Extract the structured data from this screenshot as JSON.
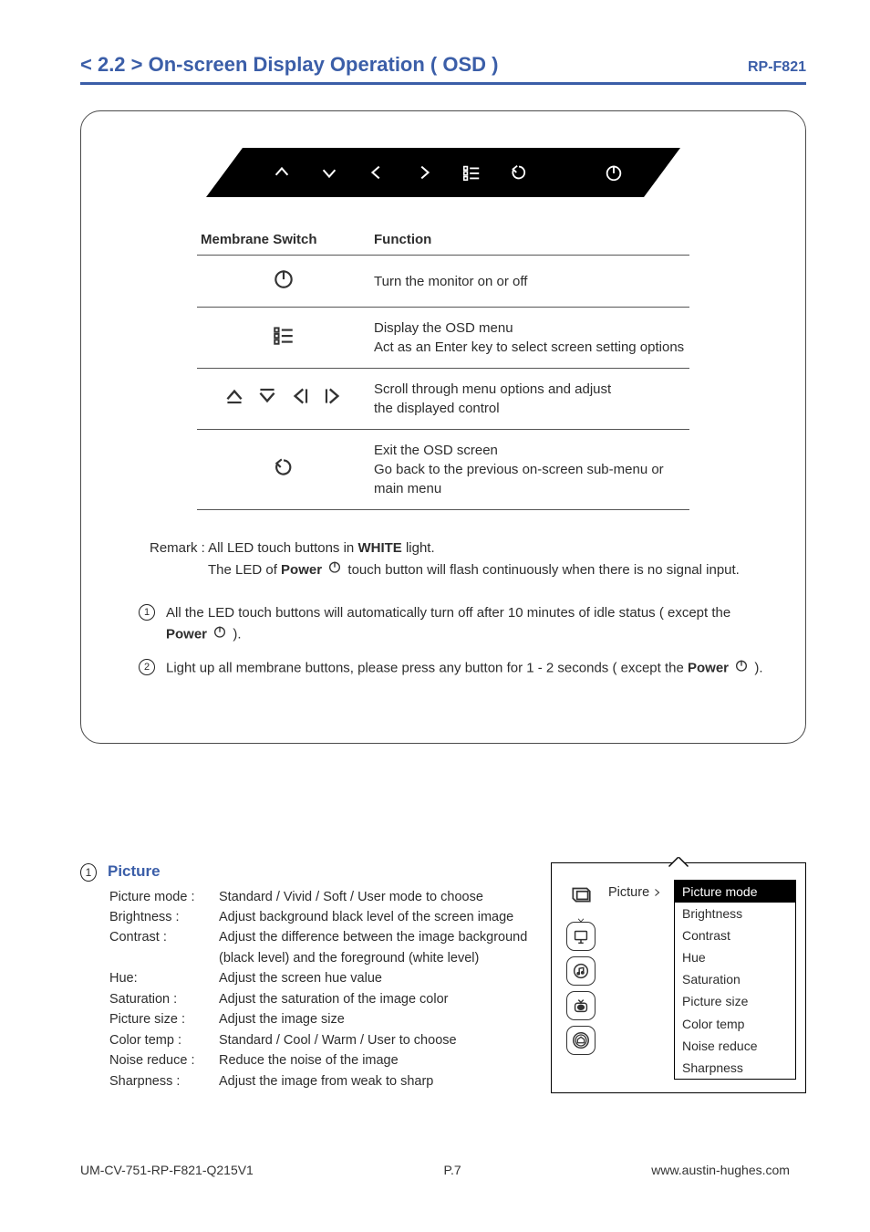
{
  "header": {
    "title": "< 2.2 > On-screen Display Operation ( OSD )",
    "model": "RP-F821"
  },
  "switch_table": {
    "h1": "Membrane Switch",
    "h2": "Function",
    "rows": [
      {
        "icons": [
          "power"
        ],
        "fn": "Turn the monitor on or off"
      },
      {
        "icons": [
          "menu"
        ],
        "fn": "Display the OSD menu\nAct as an Enter key to select screen setting options"
      },
      {
        "icons": [
          "up",
          "down",
          "left",
          "right"
        ],
        "fn": "Scroll through menu options and adjust\nthe displayed control"
      },
      {
        "icons": [
          "back"
        ],
        "fn": "Exit the OSD screen\nGo back to the previous on-screen sub-menu or main menu"
      }
    ]
  },
  "remark": {
    "l1a": "Remark : All LED touch buttons in ",
    "l1b": "WHITE",
    "l1c": " light.",
    "l2a": "The LED of ",
    "l2b": "Power",
    "l2c": " touch button will flash continuously when there is no signal input."
  },
  "notes": [
    {
      "n": "1",
      "a": "All the LED touch buttons will automatically turn off after 10 minutes of idle status ( except the ",
      "b": "Power",
      "c": " )."
    },
    {
      "n": "2",
      "a": "Light up all membrane buttons, please press any button for 1 - 2 seconds ( except the ",
      "b": "Power",
      "c": " )."
    }
  ],
  "picture": {
    "num": "1",
    "title": "Picture",
    "items": [
      {
        "k": "Picture mode :",
        "v": "Standard / Vivid / Soft / User mode to choose"
      },
      {
        "k": "Brightness :",
        "v": "Adjust background black level of the screen image"
      },
      {
        "k": "Contrast :",
        "v": "Adjust the difference between the image background (black level) and the foreground (white level)"
      },
      {
        "k": " Hue:",
        "v": "Adjust the screen hue value"
      },
      {
        "k": "Saturation :",
        "v": "Adjust the saturation of the image color"
      },
      {
        "k": "Picture size :",
        "v": "Adjust the image size"
      },
      {
        "k": "Color temp :",
        "v": "Standard / Cool / Warm / User to choose"
      },
      {
        "k": "Noise reduce :",
        "v": "Reduce the noise of the image"
      },
      {
        "k": "Sharpness :",
        "v": "Adjust the image from weak to sharp"
      }
    ]
  },
  "osd": {
    "label": "Picture",
    "menu": [
      "Picture mode",
      "Brightness",
      "Contrast",
      "Hue",
      "Saturation",
      "Picture size",
      "Color temp",
      "Noise reduce",
      "Sharpness"
    ],
    "selected": 0
  },
  "footer": {
    "left": "UM-CV-751-RP-F821-Q215V1",
    "center": "P.7",
    "right": "www.austin-hughes.com"
  }
}
